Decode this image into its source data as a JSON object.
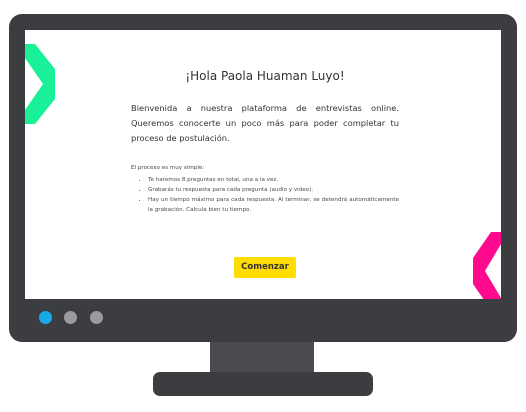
{
  "screen": {
    "greeting": "¡Hola Paola Huaman Luyo!",
    "welcome": "Bienvenida a nuestra plataforma de entrevistas online. Queremos conocerte un poco más para poder completar tu proceso de postulación.",
    "intro": "El proceso es muy simple:",
    "steps": [
      "Te haremos 8 preguntas en total, una a la vez.",
      "Grabarás tu respuesta para cada pregunta (audio y video).",
      "Hay un tiempo máximo para cada respuesta. Al terminar, se detendrá automáticamente la grabación. Calcula bien tu tiempo."
    ],
    "start_label": "Comenzar"
  },
  "colors": {
    "left_chevron": "#19f097",
    "right_chevron": "#ff0a8f",
    "button": "#ffdd00",
    "monitor": "#3c3d41",
    "active_dot": "#17a9e8",
    "inactive_dot": "#9a9b9e"
  }
}
